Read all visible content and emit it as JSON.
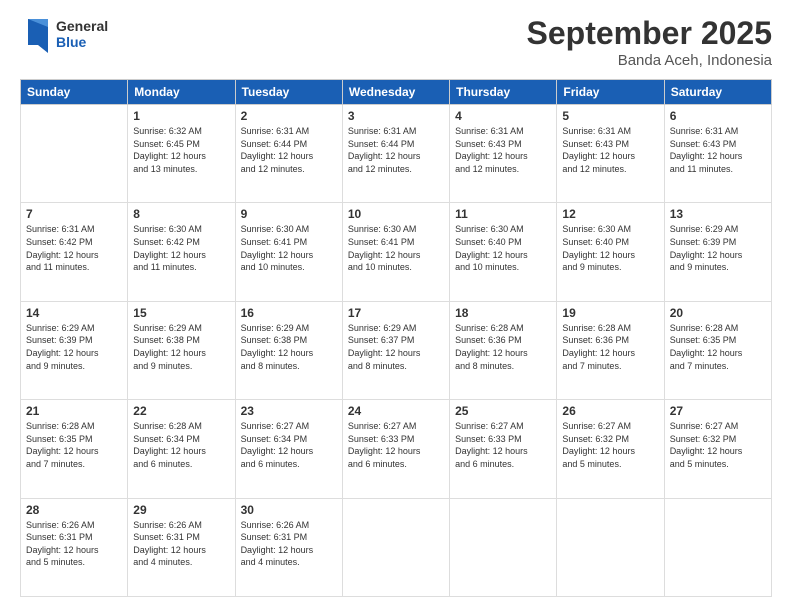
{
  "logo": {
    "general": "General",
    "blue": "Blue"
  },
  "header": {
    "month": "September 2025",
    "location": "Banda Aceh, Indonesia"
  },
  "weekdays": [
    "Sunday",
    "Monday",
    "Tuesday",
    "Wednesday",
    "Thursday",
    "Friday",
    "Saturday"
  ],
  "weeks": [
    [
      {
        "day": "",
        "info": ""
      },
      {
        "day": "1",
        "info": "Sunrise: 6:32 AM\nSunset: 6:45 PM\nDaylight: 12 hours\nand 13 minutes."
      },
      {
        "day": "2",
        "info": "Sunrise: 6:31 AM\nSunset: 6:44 PM\nDaylight: 12 hours\nand 12 minutes."
      },
      {
        "day": "3",
        "info": "Sunrise: 6:31 AM\nSunset: 6:44 PM\nDaylight: 12 hours\nand 12 minutes."
      },
      {
        "day": "4",
        "info": "Sunrise: 6:31 AM\nSunset: 6:43 PM\nDaylight: 12 hours\nand 12 minutes."
      },
      {
        "day": "5",
        "info": "Sunrise: 6:31 AM\nSunset: 6:43 PM\nDaylight: 12 hours\nand 12 minutes."
      },
      {
        "day": "6",
        "info": "Sunrise: 6:31 AM\nSunset: 6:43 PM\nDaylight: 12 hours\nand 11 minutes."
      }
    ],
    [
      {
        "day": "7",
        "info": "Sunrise: 6:31 AM\nSunset: 6:42 PM\nDaylight: 12 hours\nand 11 minutes."
      },
      {
        "day": "8",
        "info": "Sunrise: 6:30 AM\nSunset: 6:42 PM\nDaylight: 12 hours\nand 11 minutes."
      },
      {
        "day": "9",
        "info": "Sunrise: 6:30 AM\nSunset: 6:41 PM\nDaylight: 12 hours\nand 10 minutes."
      },
      {
        "day": "10",
        "info": "Sunrise: 6:30 AM\nSunset: 6:41 PM\nDaylight: 12 hours\nand 10 minutes."
      },
      {
        "day": "11",
        "info": "Sunrise: 6:30 AM\nSunset: 6:40 PM\nDaylight: 12 hours\nand 10 minutes."
      },
      {
        "day": "12",
        "info": "Sunrise: 6:30 AM\nSunset: 6:40 PM\nDaylight: 12 hours\nand 9 minutes."
      },
      {
        "day": "13",
        "info": "Sunrise: 6:29 AM\nSunset: 6:39 PM\nDaylight: 12 hours\nand 9 minutes."
      }
    ],
    [
      {
        "day": "14",
        "info": "Sunrise: 6:29 AM\nSunset: 6:39 PM\nDaylight: 12 hours\nand 9 minutes."
      },
      {
        "day": "15",
        "info": "Sunrise: 6:29 AM\nSunset: 6:38 PM\nDaylight: 12 hours\nand 9 minutes."
      },
      {
        "day": "16",
        "info": "Sunrise: 6:29 AM\nSunset: 6:38 PM\nDaylight: 12 hours\nand 8 minutes."
      },
      {
        "day": "17",
        "info": "Sunrise: 6:29 AM\nSunset: 6:37 PM\nDaylight: 12 hours\nand 8 minutes."
      },
      {
        "day": "18",
        "info": "Sunrise: 6:28 AM\nSunset: 6:36 PM\nDaylight: 12 hours\nand 8 minutes."
      },
      {
        "day": "19",
        "info": "Sunrise: 6:28 AM\nSunset: 6:36 PM\nDaylight: 12 hours\nand 7 minutes."
      },
      {
        "day": "20",
        "info": "Sunrise: 6:28 AM\nSunset: 6:35 PM\nDaylight: 12 hours\nand 7 minutes."
      }
    ],
    [
      {
        "day": "21",
        "info": "Sunrise: 6:28 AM\nSunset: 6:35 PM\nDaylight: 12 hours\nand 7 minutes."
      },
      {
        "day": "22",
        "info": "Sunrise: 6:28 AM\nSunset: 6:34 PM\nDaylight: 12 hours\nand 6 minutes."
      },
      {
        "day": "23",
        "info": "Sunrise: 6:27 AM\nSunset: 6:34 PM\nDaylight: 12 hours\nand 6 minutes."
      },
      {
        "day": "24",
        "info": "Sunrise: 6:27 AM\nSunset: 6:33 PM\nDaylight: 12 hours\nand 6 minutes."
      },
      {
        "day": "25",
        "info": "Sunrise: 6:27 AM\nSunset: 6:33 PM\nDaylight: 12 hours\nand 6 minutes."
      },
      {
        "day": "26",
        "info": "Sunrise: 6:27 AM\nSunset: 6:32 PM\nDaylight: 12 hours\nand 5 minutes."
      },
      {
        "day": "27",
        "info": "Sunrise: 6:27 AM\nSunset: 6:32 PM\nDaylight: 12 hours\nand 5 minutes."
      }
    ],
    [
      {
        "day": "28",
        "info": "Sunrise: 6:26 AM\nSunset: 6:31 PM\nDaylight: 12 hours\nand 5 minutes."
      },
      {
        "day": "29",
        "info": "Sunrise: 6:26 AM\nSunset: 6:31 PM\nDaylight: 12 hours\nand 4 minutes."
      },
      {
        "day": "30",
        "info": "Sunrise: 6:26 AM\nSunset: 6:31 PM\nDaylight: 12 hours\nand 4 minutes."
      },
      {
        "day": "",
        "info": ""
      },
      {
        "day": "",
        "info": ""
      },
      {
        "day": "",
        "info": ""
      },
      {
        "day": "",
        "info": ""
      }
    ]
  ]
}
